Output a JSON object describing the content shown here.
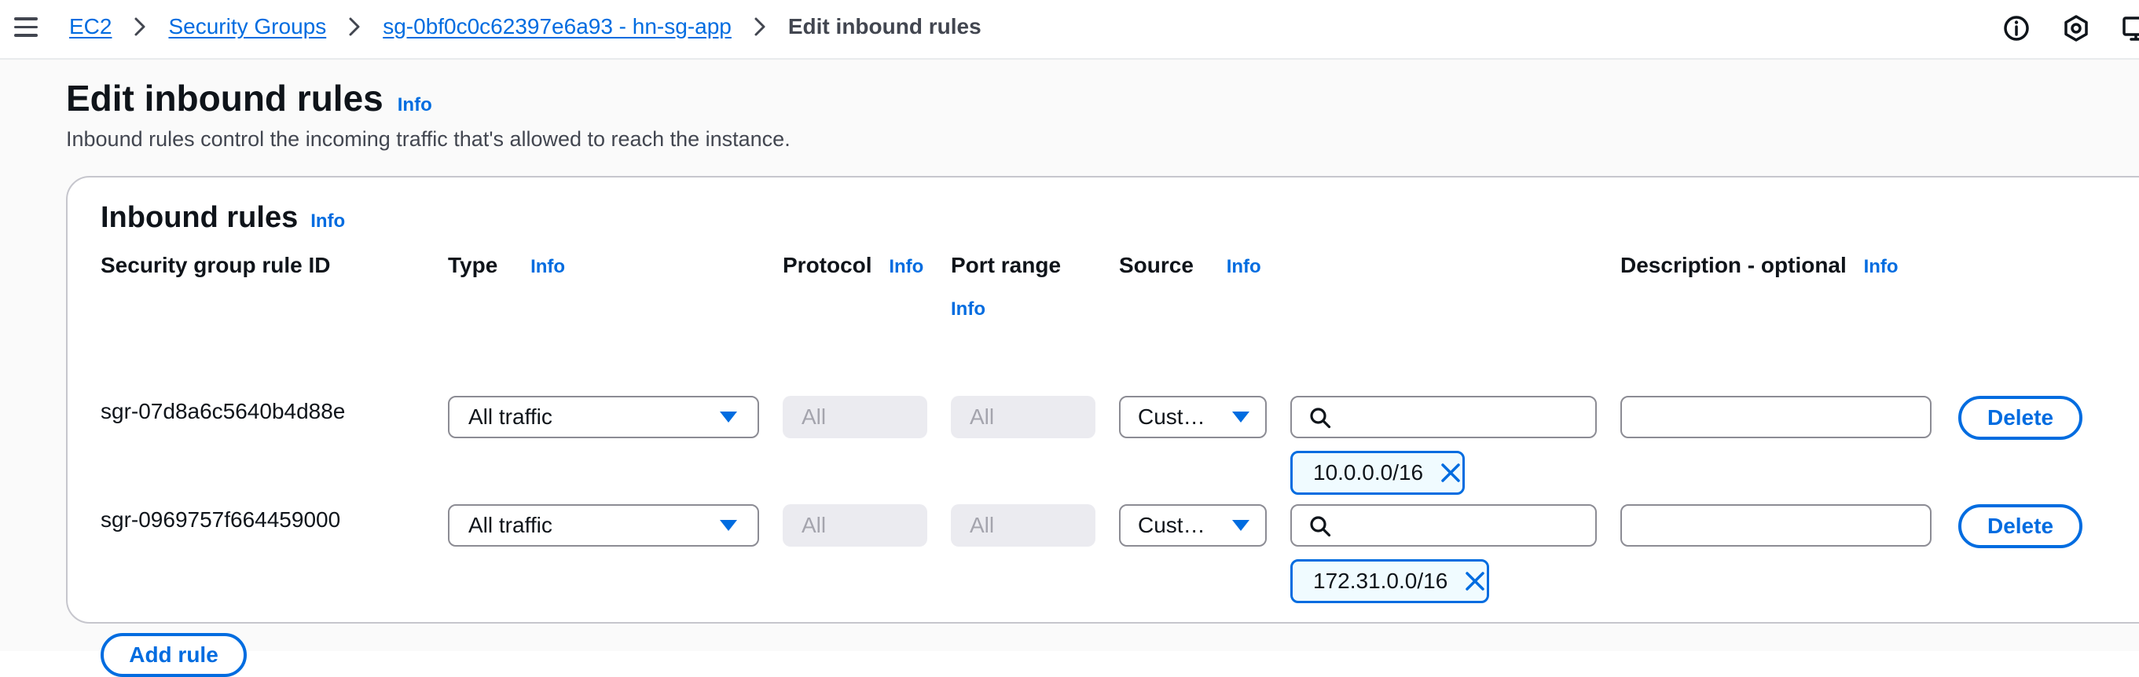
{
  "breadcrumb": {
    "items": [
      "EC2",
      "Security Groups",
      "sg-0bf0c0c62397e6a93 - hn-sg-app"
    ],
    "current": "Edit inbound rules"
  },
  "header_icons": [
    "info-circle-icon",
    "settings-hexagon-icon",
    "monitor-feedback-icon"
  ],
  "page": {
    "title": "Edit inbound rules",
    "title_info": "Info",
    "description": "Inbound rules control the incoming traffic that's allowed to reach the instance."
  },
  "card": {
    "title": "Inbound rules",
    "title_info": "Info",
    "columns": {
      "rule_id": "Security group rule ID",
      "type": "Type",
      "type_info": "Info",
      "protocol": "Protocol",
      "protocol_info": "Info",
      "port_range": "Port range",
      "port_range_info": "Info",
      "source": "Source",
      "source_info": "Info",
      "description": "Description - optional",
      "description_info": "Info"
    },
    "rules": [
      {
        "id": "sgr-07d8a6c5640b4d88e",
        "type": "All traffic",
        "protocol": "All",
        "port_range": "All",
        "source": "Cust…",
        "search_value": "",
        "token": "10.0.0.0/16",
        "description": "",
        "delete_label": "Delete"
      },
      {
        "id": "sgr-0969757f664459000",
        "type": "All traffic",
        "protocol": "All",
        "port_range": "All",
        "source": "Cust…",
        "search_value": "",
        "token": "172.31.0.0/16",
        "description": "",
        "delete_label": "Delete"
      }
    ],
    "add_rule_label": "Add rule"
  },
  "colors": {
    "link": "#006ce0",
    "text": "#0f141a",
    "muted_text": "#424650",
    "border": "#8c8c94",
    "disabled_bg": "#ebebf0",
    "token_bg": "#f0fbff"
  }
}
